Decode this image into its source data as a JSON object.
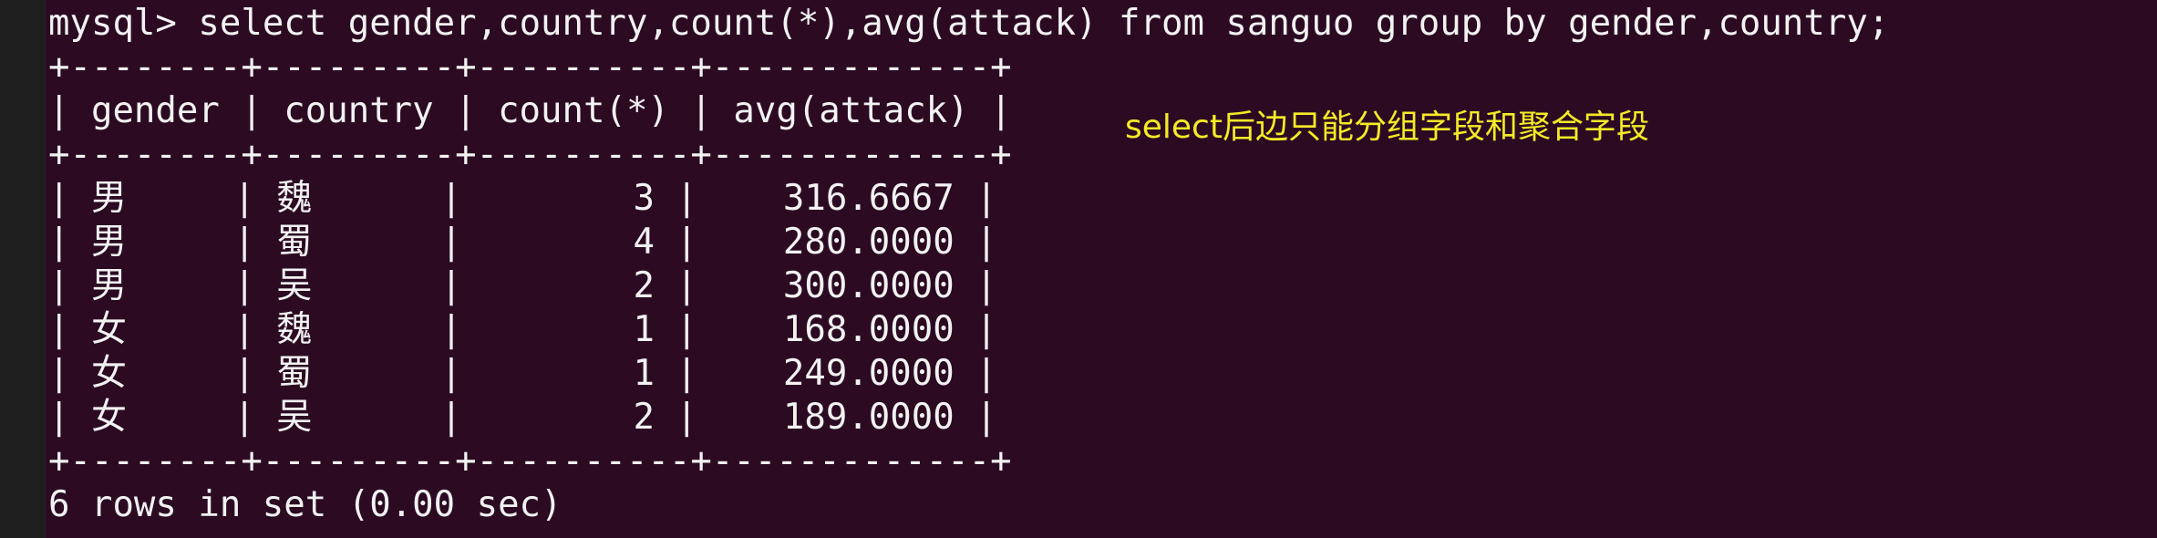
{
  "terminal": {
    "prompt": "mysql> ",
    "command": "select gender,country,count(*),avg(attack) from sanguo group by gender,country;",
    "table": {
      "border_top": "+--------+---------+----------+-------------+",
      "header": "| gender | country | count(*) | avg(attack) |",
      "border_mid": "+--------+---------+----------+-------------+",
      "rows": [
        "| 男     | 魏      |        3 |    316.6667 |",
        "| 男     | 蜀      |        4 |    280.0000 |",
        "| 男     | 吴      |        2 |    300.0000 |",
        "| 女     | 魏      |        1 |    168.0000 |",
        "| 女     | 蜀      |        1 |    249.0000 |",
        "| 女     | 吴      |        2 |    189.0000 |"
      ],
      "border_bottom": "+--------+---------+----------+-------------+"
    },
    "result_summary": "6 rows in set (0.00 sec)"
  },
  "annotation": {
    "text": "select后边只能分组字段和聚合字段",
    "color": "#f4ea27"
  },
  "colors": {
    "terminal_background": "#2c0b22",
    "terminal_text": "#f2f2f2"
  }
}
